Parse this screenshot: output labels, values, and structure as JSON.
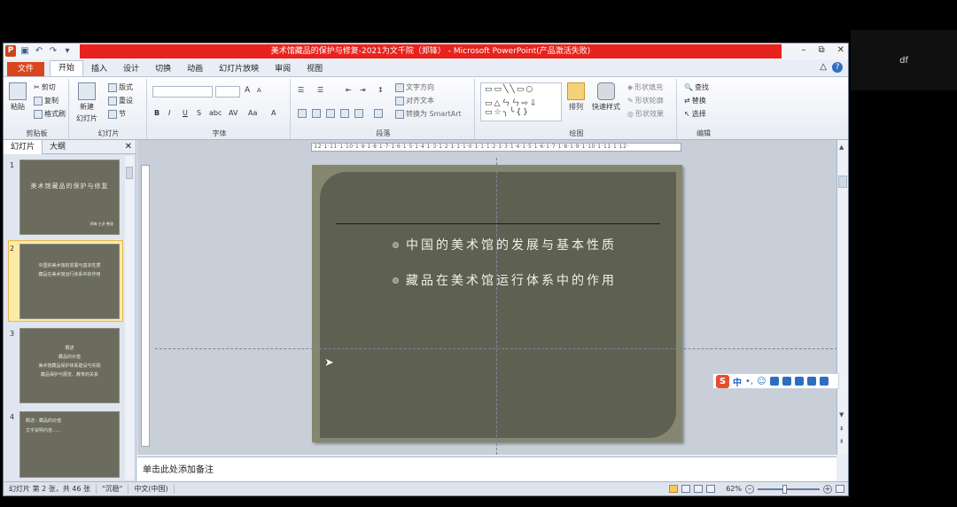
{
  "side_panel": {
    "label": "df"
  },
  "window": {
    "title": "美术馆藏品的保护与修复-2021为文千院（郑锋） - Microsoft PowerPoint(产品激活失败)",
    "controls": [
      "–",
      "⧉",
      "✕"
    ]
  },
  "qat": [
    "P",
    "💾",
    "↶",
    "↷",
    "▾"
  ],
  "ribbon": {
    "tabs": [
      "文件",
      "开始",
      "插入",
      "设计",
      "切换",
      "动画",
      "幻灯片放映",
      "审阅",
      "视图"
    ],
    "active_tab": "开始",
    "clipboard": {
      "paste": "粘贴",
      "cut": "剪切",
      "copy": "复制",
      "format_painter": "格式刷",
      "label": "剪贴板"
    },
    "slides": {
      "new_slide": "新建",
      "new_slide2": "幻灯片",
      "layout": "版式",
      "reset": "重设",
      "section": "节",
      "label": "幻灯片"
    },
    "font": {
      "label": "字体",
      "bold": "B",
      "italic": "I",
      "underline": "U",
      "strike": "S",
      "shadow": "abc",
      "spacing": "AV",
      "case": "Aa",
      "color": "A",
      "grow": "A",
      "shrink": "A"
    },
    "paragraph": {
      "text_direction": "文字方向",
      "align_text": "对齐文本",
      "smartart": "转换为 SmartArt",
      "label": "段落"
    },
    "drawing": {
      "arrange": "排列",
      "quick_styles": "快速样式",
      "fill": "形状填充",
      "outline": "形状轮廓",
      "effects": "形状效果",
      "label": "绘图"
    },
    "editing": {
      "find": "查找",
      "replace": "替换",
      "select": "选择",
      "label": "编辑"
    }
  },
  "slide_pane": {
    "tabs": [
      "幻灯片",
      "大纲"
    ],
    "active_tab": "幻灯片",
    "close": "✕",
    "thumbs": [
      {
        "num": "1",
        "title": "美术馆藏品的保护与修复",
        "sub": "郑锋 主讲 整理"
      },
      {
        "num": "2",
        "line1": "中国的美术馆的发展与基本性质",
        "line2": "藏品在美术馆运行体系中的作用"
      },
      {
        "num": "3",
        "line1": "概述",
        "line2": "藏品的价值",
        "line3": "美术馆藏品保护体系建设与实践",
        "line4": "藏品保护与展览、教育的关系"
      },
      {
        "num": "4",
        "line1": "概述：藏品的价值",
        "line2": "文字说明内容……"
      }
    ]
  },
  "slide": {
    "bullets": [
      "中国的美术馆的发展与基本性质",
      "藏品在美术馆运行体系中的作用"
    ]
  },
  "ruler_text": "·12·1·11·1·10·1·9·1·8·1·7·1·6·1·5·1·4·1·3·1·2·1·1·1·0·1·1·1·2·1·3·1·4·1·5·1·6·1·7·1·8·1·9·1·10·1·11·1·12·",
  "ime": {
    "logo": "S",
    "lang": "中",
    "punct": "•,",
    "emoji": "☺",
    "mic": "🎤"
  },
  "notes": {
    "placeholder": "单击此处添加备注"
  },
  "statusbar": {
    "slide_info": "幻灯片 第 2 张，共 46 张",
    "theme": "\"沉稳\"",
    "language": "中文(中国)",
    "zoom": "62%"
  }
}
